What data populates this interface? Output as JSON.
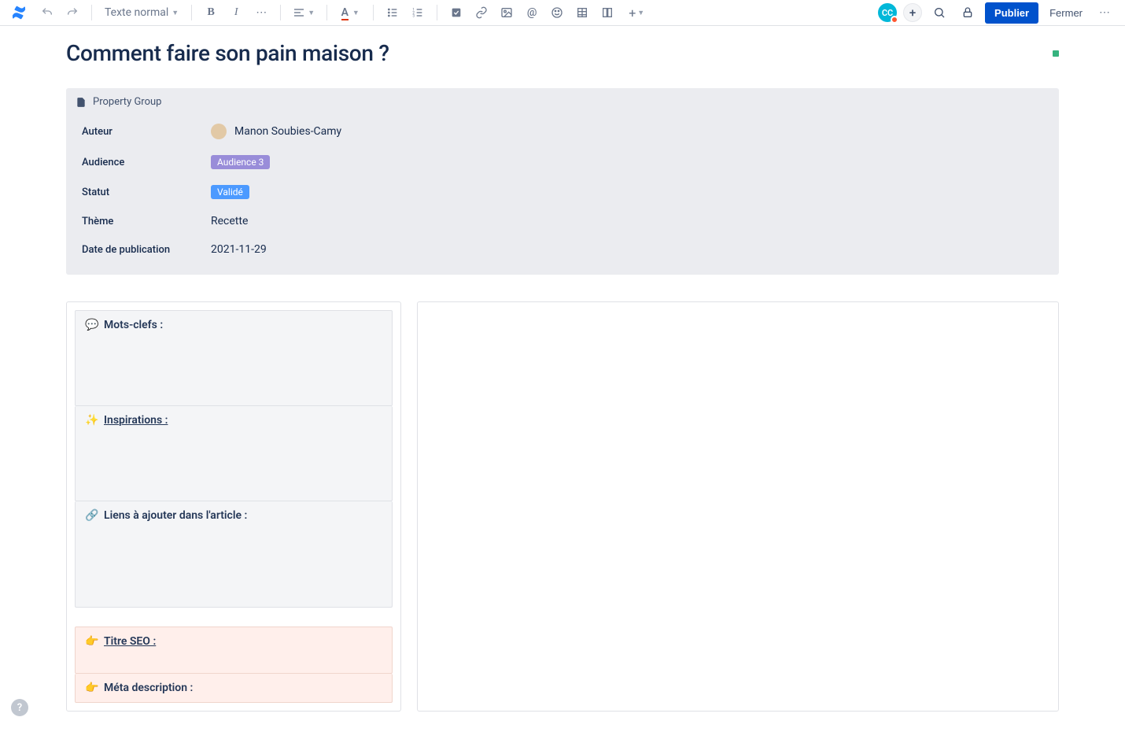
{
  "toolbar": {
    "text_style_label": "Texte normal",
    "publish_label": "Publier",
    "close_label": "Fermer",
    "avatar_initials": "CC"
  },
  "page": {
    "title": "Comment faire son pain maison ?"
  },
  "property_group": {
    "header": "Property Group",
    "rows": {
      "author": {
        "label": "Auteur",
        "value": "Manon Soubies-Camy"
      },
      "audience": {
        "label": "Audience",
        "tag": "Audience 3"
      },
      "status": {
        "label": "Statut",
        "tag": "Validé"
      },
      "theme": {
        "label": "Thème",
        "value": "Recette"
      },
      "date": {
        "label": "Date de publication",
        "value": "2021-11-29"
      }
    }
  },
  "panels": {
    "keywords": {
      "emoji": "💬",
      "label": "Mots-clefs :"
    },
    "inspirations": {
      "emoji": "✨",
      "label": "Inspirations :"
    },
    "links": {
      "emoji": "🔗",
      "label": "Liens à ajouter dans l'article :"
    },
    "seo_title": {
      "emoji": "👉",
      "label": "Titre SEO :"
    },
    "meta_desc": {
      "emoji": "👉",
      "label": "Méta description :"
    }
  },
  "help_label": "?"
}
